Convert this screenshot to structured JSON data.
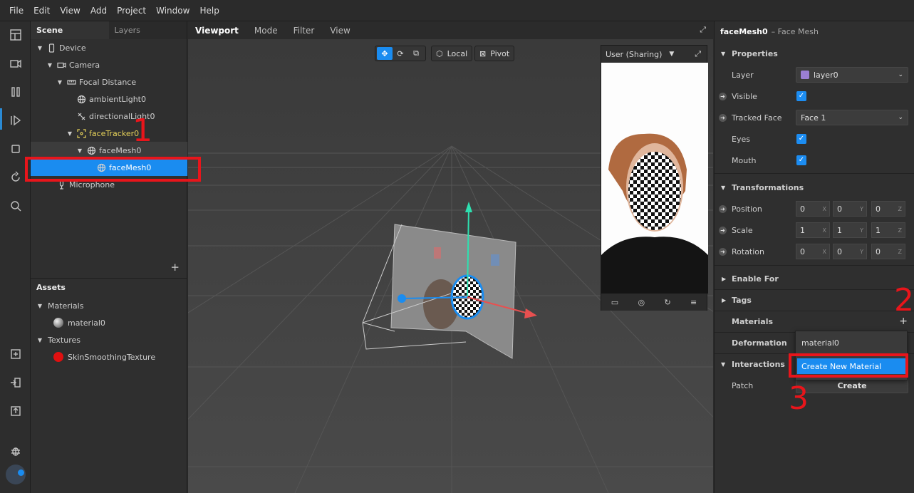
{
  "menu": [
    "File",
    "Edit",
    "View",
    "Add",
    "Project",
    "Window",
    "Help"
  ],
  "scene_panel": {
    "tabs": [
      "Scene",
      "Layers"
    ],
    "tree": [
      {
        "label": "Device",
        "icon": "phone-icon",
        "depth": 0,
        "expanded": true
      },
      {
        "label": "Camera",
        "icon": "camera-icon",
        "depth": 1,
        "expanded": true
      },
      {
        "label": "Focal Distance",
        "icon": "ruler-icon",
        "depth": 2,
        "expanded": true
      },
      {
        "label": "ambientLight0",
        "icon": "globe-icon",
        "depth": 3
      },
      {
        "label": "directionalLight0",
        "icon": "light-icon",
        "depth": 3
      },
      {
        "label": "faceTracker0",
        "icon": "face-tracker-icon",
        "depth": 3,
        "expanded": true
      },
      {
        "label": "faceMesh0",
        "icon": "mesh-icon",
        "depth": 4,
        "expanded": true
      },
      {
        "label": "faceMesh0",
        "icon": "mesh-icon",
        "depth": 5,
        "selected": true
      },
      {
        "label": "Microphone",
        "icon": "microphone-icon",
        "depth": 1
      }
    ],
    "add_label": "+"
  },
  "assets_panel": {
    "title": "Assets",
    "groups": [
      {
        "name": "Materials",
        "items": [
          "material0"
        ]
      },
      {
        "name": "Textures",
        "items": [
          "SkinSmoothingTexture"
        ]
      }
    ]
  },
  "viewport": {
    "tabs": [
      "Viewport",
      "Mode",
      "Filter",
      "View"
    ],
    "local_label": "Local",
    "pivot_label": "Pivot",
    "preview_title": "User (Sharing)"
  },
  "properties": {
    "title": "faceMesh0",
    "subtitle": "– Face Mesh",
    "section_properties": "Properties",
    "layer_label": "Layer",
    "layer_value": "layer0",
    "visible_label": "Visible",
    "tracked_face_label": "Tracked Face",
    "tracked_face_value": "Face 1",
    "eyes_label": "Eyes",
    "mouth_label": "Mouth",
    "section_transformations": "Transformations",
    "position_label": "Position",
    "position": [
      "0",
      "0",
      "0"
    ],
    "scale_label": "Scale",
    "scale": [
      "1",
      "1",
      "1"
    ],
    "rotation_label": "Rotation",
    "rotation": [
      "0",
      "0",
      "0"
    ],
    "axes": [
      "X",
      "Y",
      "Z"
    ],
    "enable_for": "Enable For",
    "tags": "Tags",
    "materials": "Materials",
    "deformation": "Deformation",
    "interactions": "Interactions",
    "patch_label": "Patch",
    "create_label": "Create",
    "menu_material": "material0",
    "menu_create_new": "Create New Material"
  },
  "annotations": [
    "1",
    "2",
    "3"
  ],
  "colors": {
    "accent": "#1a8cf0",
    "annotation": "#e8151b",
    "layer_swatch": "#9b7fd4",
    "texture_swatch": "#e01010"
  }
}
